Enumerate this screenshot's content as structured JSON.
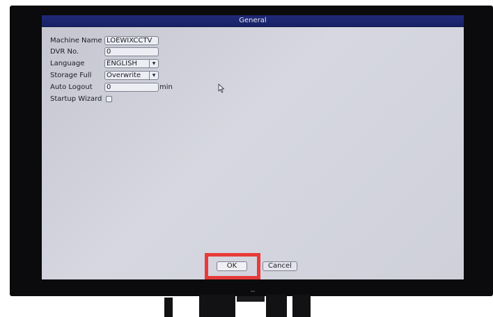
{
  "window": {
    "title": "General"
  },
  "form": {
    "machine_name": {
      "label": "Machine Name",
      "value": "LOEWIXCCTV"
    },
    "dvr_no": {
      "label": "DVR No.",
      "value": "0"
    },
    "language": {
      "label": "Language",
      "value": "ENGLISH"
    },
    "storage_full": {
      "label": "Storage Full",
      "value": "Overwrite"
    },
    "auto_logout": {
      "label": "Auto Logout",
      "value": "0",
      "unit": "min"
    },
    "startup_wizard": {
      "label": "Startup Wizard",
      "checked": false
    }
  },
  "buttons": {
    "ok": "OK",
    "cancel": "Cancel"
  },
  "icons": {
    "dropdown": "chevron-down-icon",
    "cursor": "mouse-pointer-icon"
  },
  "colors": {
    "title_bar": "#1f2a78",
    "screen_bg": "#d0d1db",
    "highlight": "#e83a3a"
  }
}
